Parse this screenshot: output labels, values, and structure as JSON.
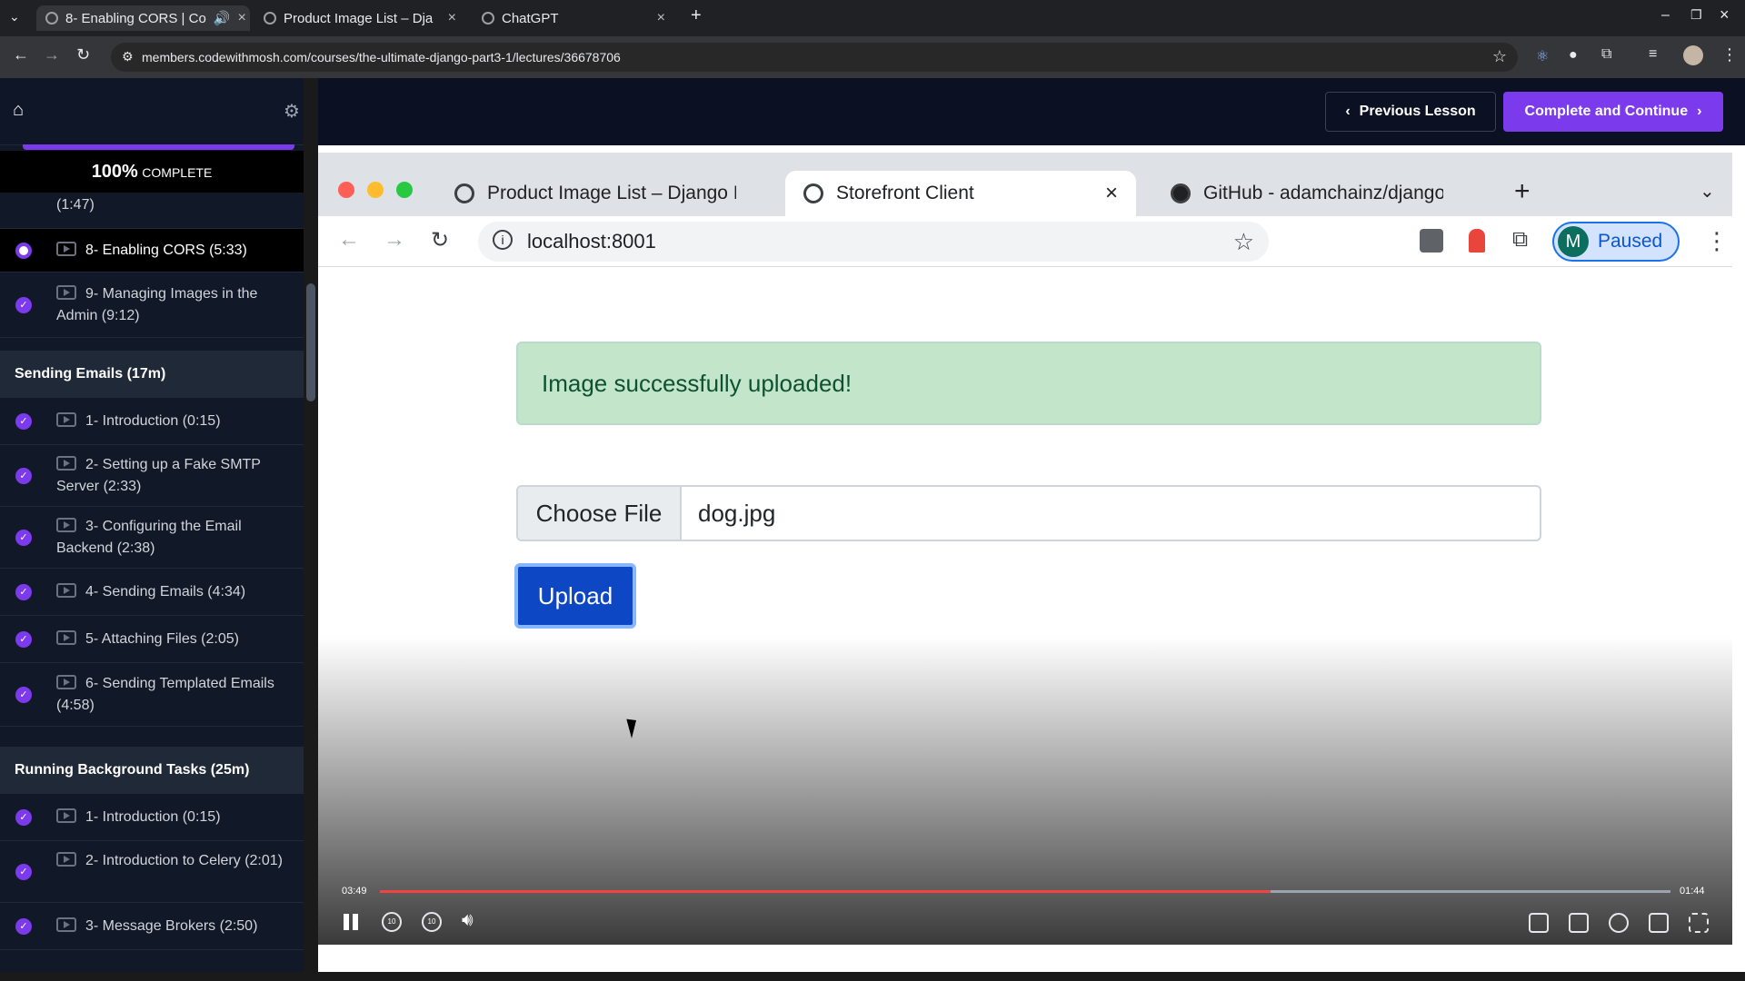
{
  "browser": {
    "tabs": [
      {
        "title": "8- Enabling CORS | Co"
      },
      {
        "title": "Product Image List – Dja"
      },
      {
        "title": "ChatGPT"
      }
    ],
    "url": "members.codewithmosh.com/courses/the-ultimate-django-part3-1/lectures/36678706"
  },
  "sidebar": {
    "progress_pct": "100%",
    "progress_label": "COMPLETE",
    "top_lessons": [
      {
        "label": "(1:47)"
      },
      {
        "label": "8- Enabling CORS (5:33)"
      },
      {
        "label": "9- Managing Images in the Admin (9:12)"
      }
    ],
    "sections": [
      {
        "title": "Sending Emails (17m)",
        "lessons": [
          "1- Introduction (0:15)",
          "2- Setting up a Fake SMTP Server (2:33)",
          "3- Configuring the Email Backend (2:38)",
          "4- Sending Emails (4:34)",
          "5- Attaching Files (2:05)",
          "6- Sending Templated Emails (4:58)"
        ]
      },
      {
        "title": "Running Background Tasks (25m)",
        "lessons": [
          "1- Introduction (0:15)",
          "2- Introduction to Celery (2:01)",
          "3- Message Brokers (2:50)"
        ]
      }
    ]
  },
  "header": {
    "prev_label": "Previous Lesson",
    "next_label": "Complete and Continue",
    "accent": "#7c3aed"
  },
  "video": {
    "tabs": [
      {
        "title": "Product Image List – Django RE"
      },
      {
        "title": "Storefront Client"
      },
      {
        "title": "GitHub - adamchainz/django-c"
      }
    ],
    "url": "localhost:8001",
    "profile_initial": "M",
    "profile_status": "Paused",
    "alert": "Image successfully uploaded!",
    "choose_file": "Choose File",
    "file_name": "dog.jpg",
    "upload": "Upload",
    "time_elapsed": "03:49",
    "time_remaining": "01:44",
    "progress": 0.69
  }
}
